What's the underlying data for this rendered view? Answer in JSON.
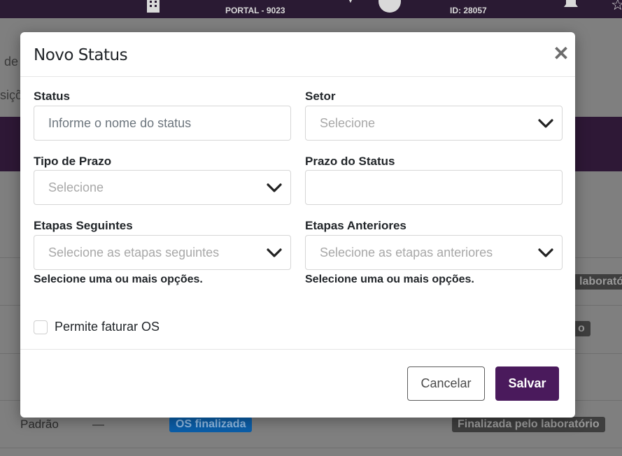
{
  "background": {
    "portal_label": "PORTAL - 9023",
    "user_id": "ID: 28057",
    "text_de": "de",
    "text_sicao": "siçõ",
    "badge_laboratorio_cut": "laborató",
    "badge_o": "o",
    "row_padrao": "Padrão",
    "row_dash": "—",
    "badge_os_finalizada": "OS finalizada",
    "badge_finalizada_lab": "Finalizada pelo laboratório"
  },
  "modal": {
    "title": "Novo Status",
    "close_symbol": "✕",
    "fields": {
      "status": {
        "label": "Status",
        "placeholder": "Informe o nome do status"
      },
      "setor": {
        "label": "Setor",
        "value": "Selecione"
      },
      "tipo_prazo": {
        "label": "Tipo de Prazo",
        "value": "Selecione"
      },
      "prazo_status": {
        "label": "Prazo do Status",
        "value": ""
      },
      "etapas_seguintes": {
        "label": "Etapas Seguintes",
        "value": "Selecione as etapas seguintes",
        "help": "Selecione uma ou mais opções."
      },
      "etapas_anteriores": {
        "label": "Etapas Anteriores",
        "value": "Selecione as etapas anteriores",
        "help": "Selecione uma ou mais opções."
      }
    },
    "checkbox": {
      "label": "Permite faturar OS",
      "checked": false
    },
    "buttons": {
      "cancel": "Cancelar",
      "save": "Salvar"
    }
  },
  "colors": {
    "primary": "#4a1a5c",
    "overlay": "#7f7f7f"
  }
}
